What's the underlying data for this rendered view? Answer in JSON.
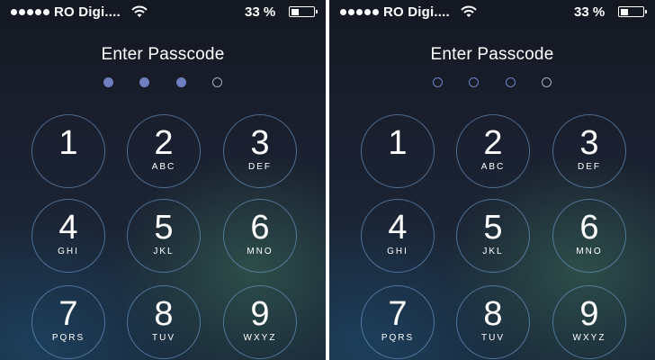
{
  "status_bar": {
    "carrier": "RO Digi....",
    "battery_percent": "33 %",
    "battery_level": 0.33,
    "signal_dots": 5
  },
  "title": "Enter Passcode",
  "keypad": [
    {
      "digit": "1",
      "letters": ""
    },
    {
      "digit": "2",
      "letters": "ABC"
    },
    {
      "digit": "3",
      "letters": "DEF"
    },
    {
      "digit": "4",
      "letters": "GHI"
    },
    {
      "digit": "5",
      "letters": "JKL"
    },
    {
      "digit": "6",
      "letters": "MNO"
    },
    {
      "digit": "7",
      "letters": "PQRS"
    },
    {
      "digit": "8",
      "letters": "TUV"
    },
    {
      "digit": "9",
      "letters": "WXYZ"
    }
  ],
  "screens": [
    {
      "name": "left",
      "entered_digits": 3,
      "passcode_length": 4
    },
    {
      "name": "right",
      "entered_digits": 0,
      "passcode_length": 4
    }
  ],
  "colors": {
    "dot_filled": "#6f7fc0",
    "dot_empty": "#a8acb8",
    "key_ring": "#78aadc"
  },
  "icons": {
    "wifi": "wifi-icon",
    "battery": "battery-icon",
    "signal": "signal-strength-icon"
  }
}
